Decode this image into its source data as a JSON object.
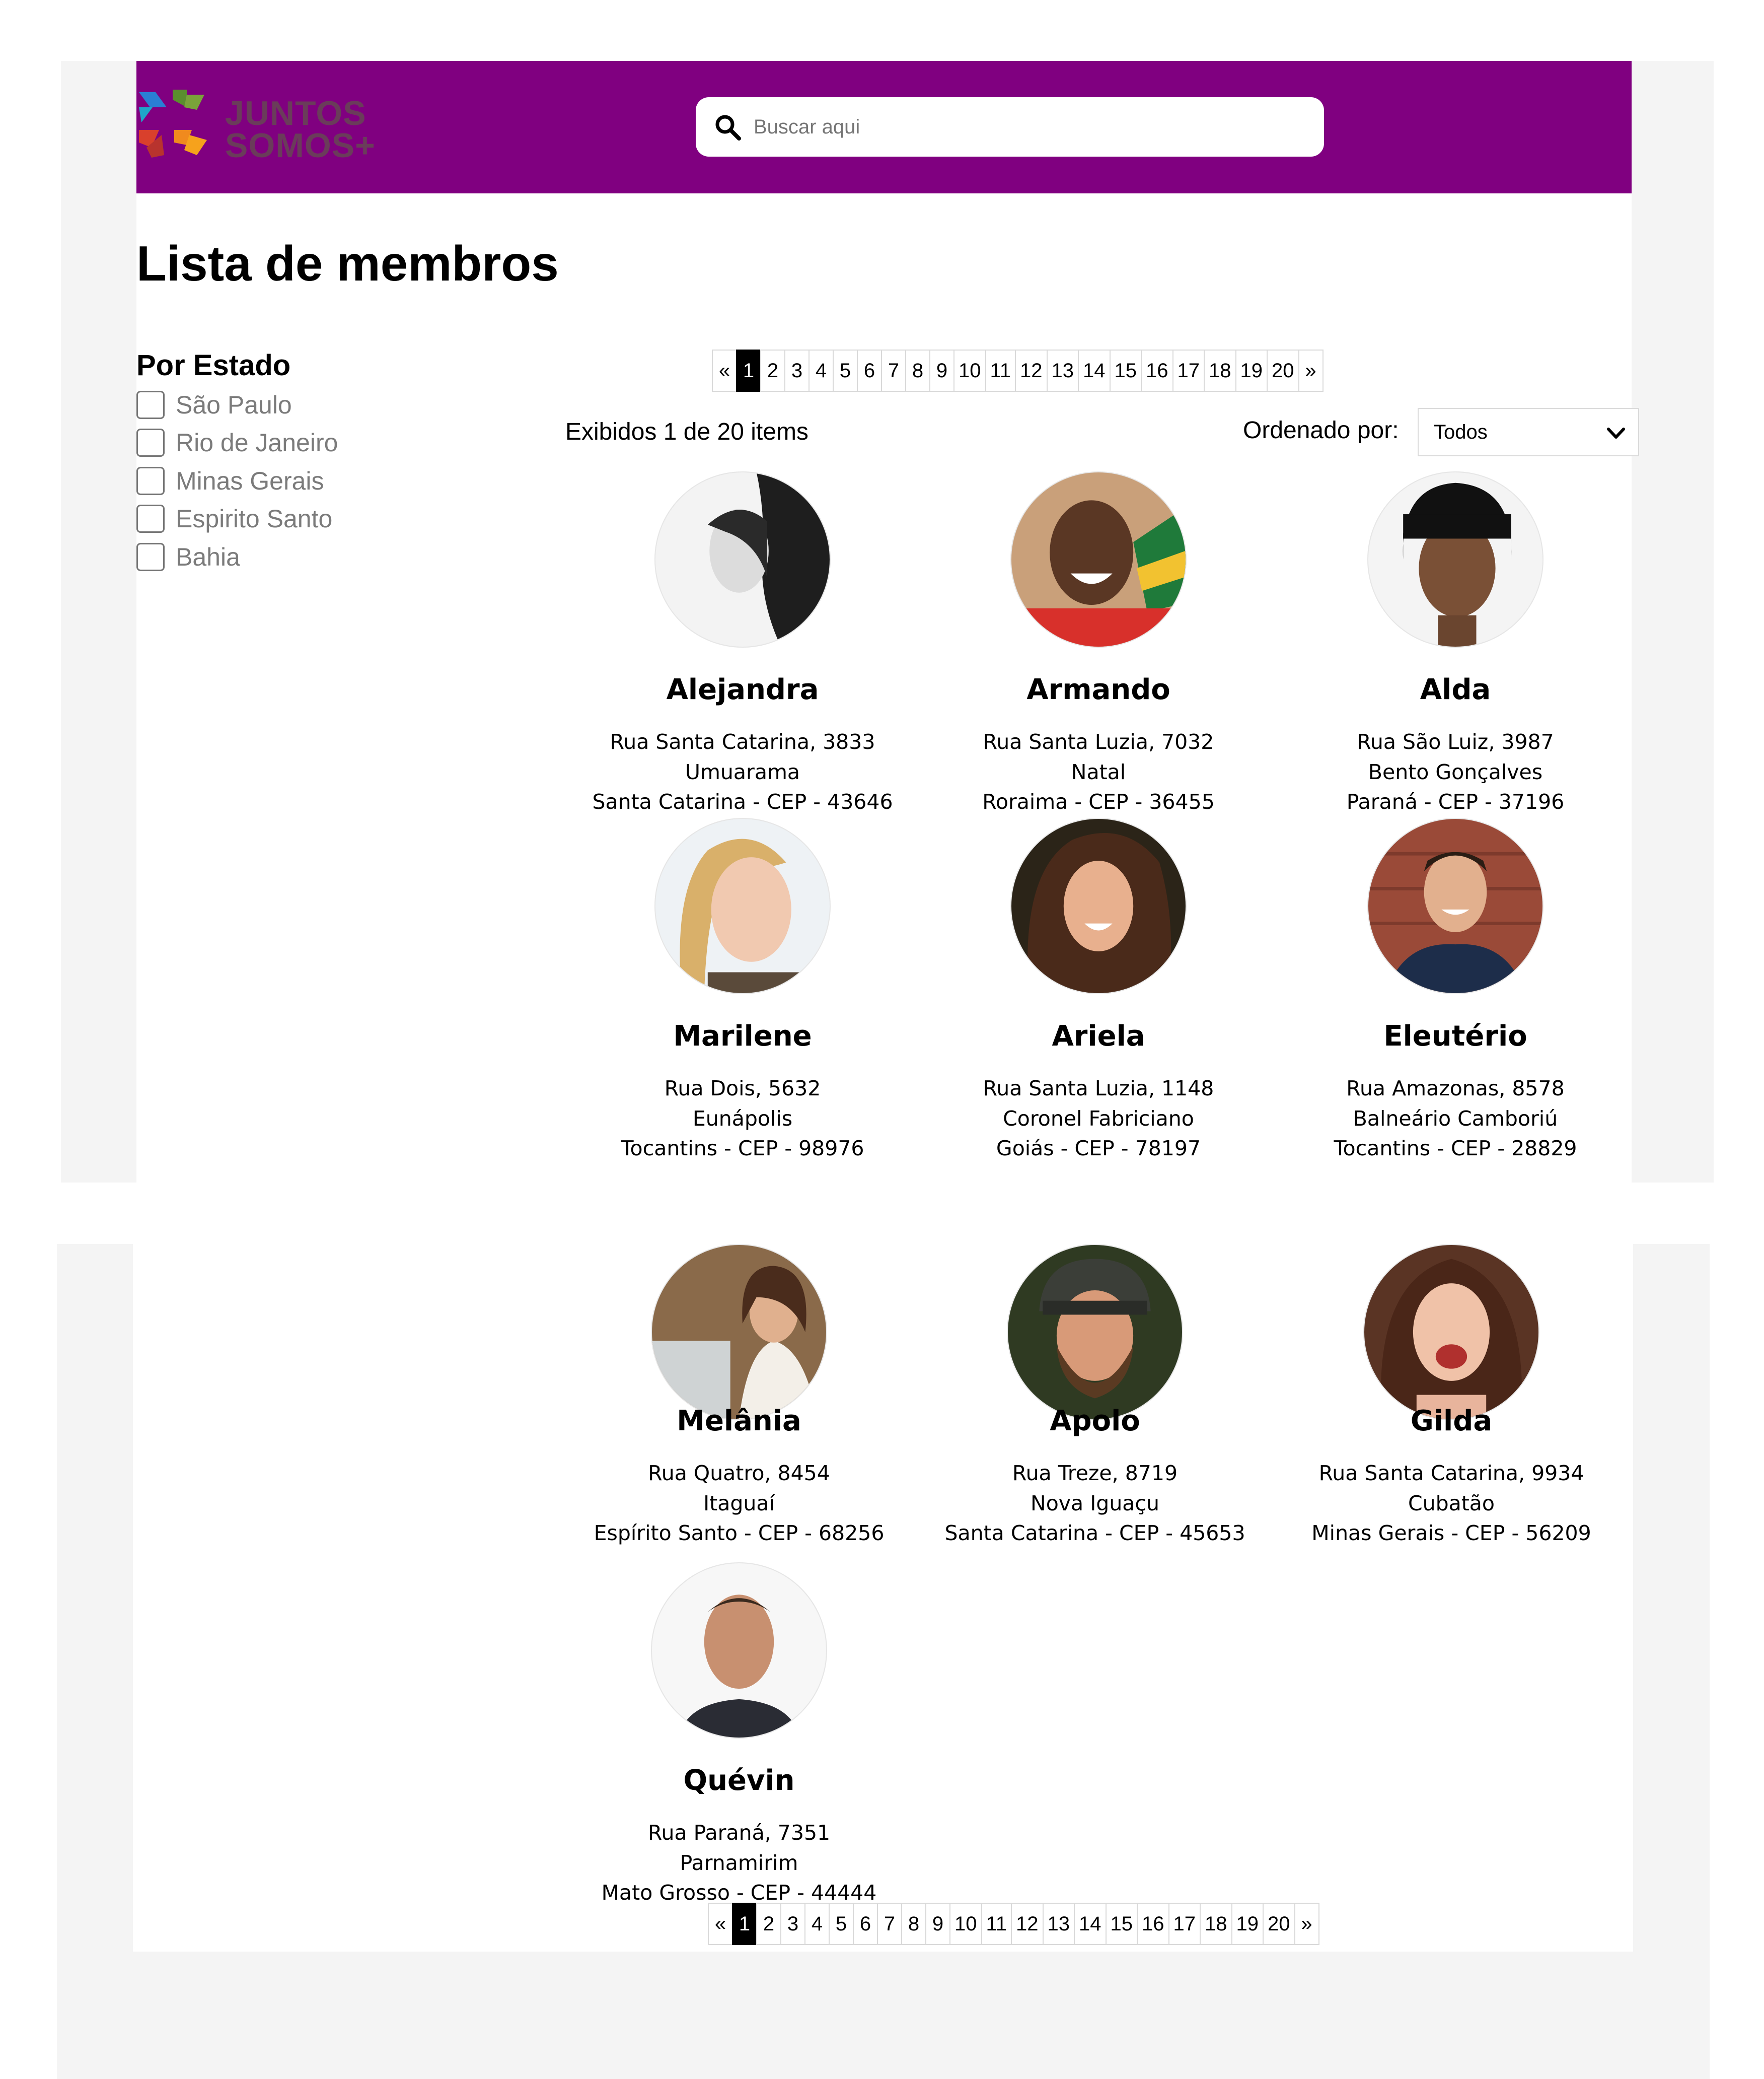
{
  "header": {
    "logo_text": "JUNTOS\nSOMOS+",
    "search_placeholder": "Buscar aqui"
  },
  "page_title": "Lista de membros",
  "filters": {
    "title": "Por Estado",
    "items": [
      "São Paulo",
      "Rio de Janeiro",
      "Minas Gerais",
      "Espirito Santo",
      "Bahia"
    ]
  },
  "pagination": {
    "prev": "«",
    "next": "»",
    "current": "1",
    "pages": [
      "1",
      "2",
      "3",
      "4",
      "5",
      "6",
      "7",
      "8",
      "9",
      "10",
      "11",
      "12",
      "13",
      "14",
      "15",
      "16",
      "17",
      "18",
      "19",
      "20"
    ]
  },
  "results": {
    "count_text": "Exibidos 1 de 20 items",
    "sort_label": "Ordenado por:",
    "sort_value": "Todos"
  },
  "members": [
    {
      "name": "Alejandra",
      "street": "Rua Santa Catarina, 3833",
      "city": "Umuarama",
      "state_cep": "Santa Catarina - CEP - 43646"
    },
    {
      "name": "Armando",
      "street": "Rua Santa Luzia, 7032",
      "city": "Natal",
      "state_cep": "Roraima - CEP - 36455"
    },
    {
      "name": "Alda",
      "street": "Rua São Luiz, 3987",
      "city": "Bento Gonçalves",
      "state_cep": "Paraná - CEP - 37196"
    },
    {
      "name": "Marilene",
      "street": "Rua Dois, 5632",
      "city": "Eunápolis",
      "state_cep": "Tocantins - CEP - 98976"
    },
    {
      "name": "Ariela",
      "street": "Rua Santa Luzia, 1148",
      "city": "Coronel Fabriciano",
      "state_cep": "Goiás - CEP - 78197"
    },
    {
      "name": "Eleutério",
      "street": "Rua Amazonas, 8578",
      "city": "Balneário Camboriú",
      "state_cep": "Tocantins - CEP - 28829"
    },
    {
      "name": "Melânia",
      "street": "Rua Quatro, 8454",
      "city": "Itaguaí",
      "state_cep": "Espírito Santo - CEP - 68256"
    },
    {
      "name": "Apolo",
      "street": "Rua Treze, 8719",
      "city": "Nova Iguaçu",
      "state_cep": "Santa Catarina - CEP - 45653"
    },
    {
      "name": "Gilda",
      "street": "Rua Santa Catarina, 9934",
      "city": "Cubatão",
      "state_cep": "Minas Gerais - CEP - 56209"
    },
    {
      "name": "Quévin",
      "street": "Rua Paraná, 7351",
      "city": "Parnamirim",
      "state_cep": "Mato Grosso - CEP - 44444"
    }
  ]
}
